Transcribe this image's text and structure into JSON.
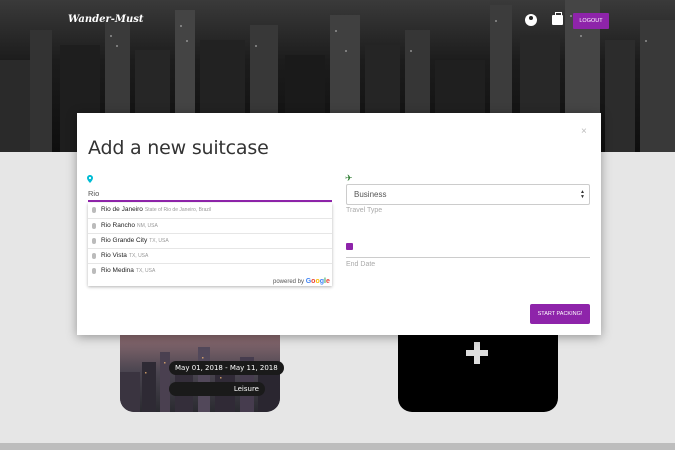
{
  "nav": {
    "brand": "Wander-Must",
    "logout": "LOGOUT",
    "icons": [
      "user-circle-icon",
      "suitcase-icon"
    ]
  },
  "modal": {
    "title": "Add a new suitcase",
    "close": "×",
    "destination_value": "Rio",
    "suggestions": [
      {
        "main": "Rio de Janeiro",
        "sub": "State of Rio de Janeiro, Brazil"
      },
      {
        "main": "Rio Rancho",
        "sub": "NM, USA"
      },
      {
        "main": "Rio Grande City",
        "sub": "TX, USA"
      },
      {
        "main": "Rio Vista",
        "sub": "TX, USA"
      },
      {
        "main": "Rio Medina",
        "sub": "TX, USA"
      }
    ],
    "powered_by": "powered by",
    "google": "Google",
    "travel_type_value": "Business",
    "travel_type_label": "Travel Type",
    "end_date_label": "End Date",
    "start_button": "START PACKING!"
  },
  "cards": {
    "trip_dates": "May 01, 2018 - May 11, 2018",
    "trip_type": "Leisure"
  },
  "colors": {
    "accent": "#8e24aa",
    "plane": "#2e7d32",
    "pin": "#00bcd4"
  }
}
